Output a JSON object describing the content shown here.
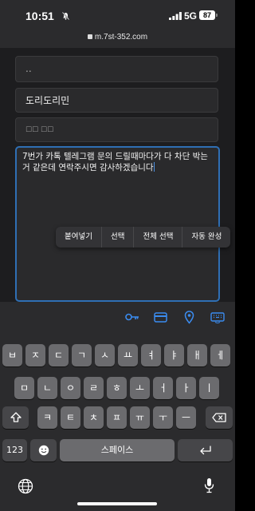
{
  "status": {
    "time": "10:51",
    "network": "5G",
    "battery": "87"
  },
  "browser": {
    "url": "m.7st-352.com"
  },
  "form": {
    "field1_value": "..",
    "field2_value": "도리도리민",
    "field3_value": "☐☐ ☐☐",
    "message_value": "7번가 카톡 텔레그램 문의 드릴때마다가 다 차단 박는거 같은데 연락주시면 감사하겠습니다"
  },
  "context_menu": {
    "paste": "붙여넣기",
    "select": "선택",
    "select_all": "전체 선택",
    "autofill": "자동 완성"
  },
  "accessory": {
    "icons": [
      "key-icon",
      "credit-card-icon",
      "location-pin-icon",
      "keyboard-icon"
    ]
  },
  "keyboard": {
    "row1": [
      "ㅂ",
      "ㅈ",
      "ㄷ",
      "ㄱ",
      "ㅅ",
      "ㅛ",
      "ㅕ",
      "ㅑ",
      "ㅐ",
      "ㅔ"
    ],
    "row2": [
      "ㅁ",
      "ㄴ",
      "ㅇ",
      "ㄹ",
      "ㅎ",
      "ㅗ",
      "ㅓ",
      "ㅏ",
      "ㅣ"
    ],
    "row3": [
      "ㅋ",
      "ㅌ",
      "ㅊ",
      "ㅍ",
      "ㅠ",
      "ㅜ",
      "ㅡ"
    ],
    "numbers_label": "123",
    "space_label": "스페이스"
  }
}
